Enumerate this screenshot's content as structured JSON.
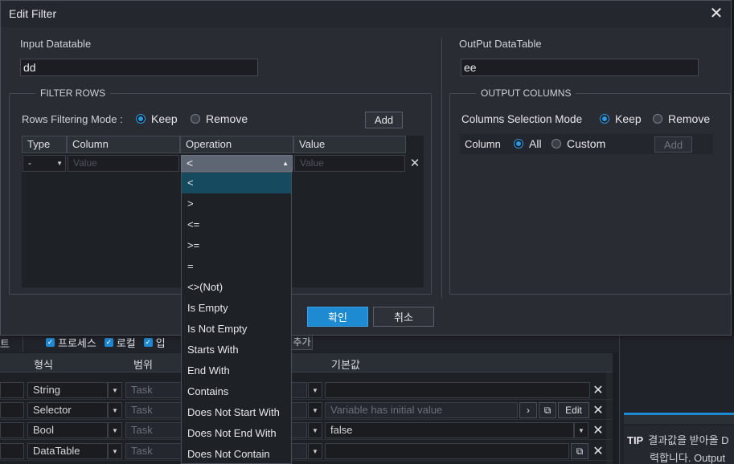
{
  "dialog": {
    "title": "Edit Filter",
    "close_glyph": "✕",
    "input_datatable_label": "Input Datatable",
    "input_datatable_value": "dd",
    "output_datatable_label": "OutPut DataTable",
    "output_datatable_value": "ee",
    "filter_rows": {
      "legend": "FILTER ROWS",
      "mode_label": "Rows Filtering Mode :",
      "keep_label": "Keep",
      "remove_label": "Remove",
      "selected_mode": "Keep",
      "add_label": "Add",
      "columns": [
        "Type",
        "Column",
        "Operation",
        "Value"
      ],
      "row": {
        "type": "-",
        "column_placeholder": "Value",
        "operation": "<",
        "value_placeholder": "Value"
      },
      "operation_options": [
        "<",
        ">",
        "<=",
        ">=",
        "=",
        "<>(Not)",
        "Is Empty",
        "Is Not Empty",
        "Starts With",
        "End With",
        "Contains",
        "Does Not Start With",
        "Does Not End With",
        "Does Not Contain"
      ],
      "operation_selected_index": 0
    },
    "output_columns": {
      "legend": "OUTPUT COLUMNS",
      "mode_label": "Columns Selection Mode",
      "keep_label": "Keep",
      "remove_label": "Remove",
      "selected_mode": "Keep",
      "column_label": "Column",
      "all_label": "All",
      "custom_label": "Custom",
      "selected_column_option": "All",
      "add_label": "Add"
    },
    "confirm_label": "확인",
    "cancel_label": "취소"
  },
  "background": {
    "tab_partial": "트",
    "checks": [
      "프로세스",
      "로컬",
      "입"
    ],
    "add_partial": "추가",
    "grid_headers": [
      "형식",
      "범위",
      "기본값"
    ],
    "rows": [
      {
        "type": "String",
        "scope": "Task",
        "default": "",
        "default_placeholder": ""
      },
      {
        "type": "Selector",
        "scope": "Task",
        "default": "",
        "default_placeholder": "Variable has initial value",
        "edit_label": "Edit"
      },
      {
        "type": "Bool",
        "scope": "Task",
        "default": "false",
        "default_placeholder": ""
      },
      {
        "type": "DataTable",
        "scope": "Task",
        "default": "",
        "default_placeholder": ""
      }
    ],
    "tip_label": "TIP",
    "tip_line1": "결과값을 받아올 D",
    "tip_line2": "력합니다. Output"
  },
  "colors": {
    "accent": "#1e8ad1",
    "dialog_bg": "#292c33",
    "dropdown_selected": "#164a5e"
  }
}
